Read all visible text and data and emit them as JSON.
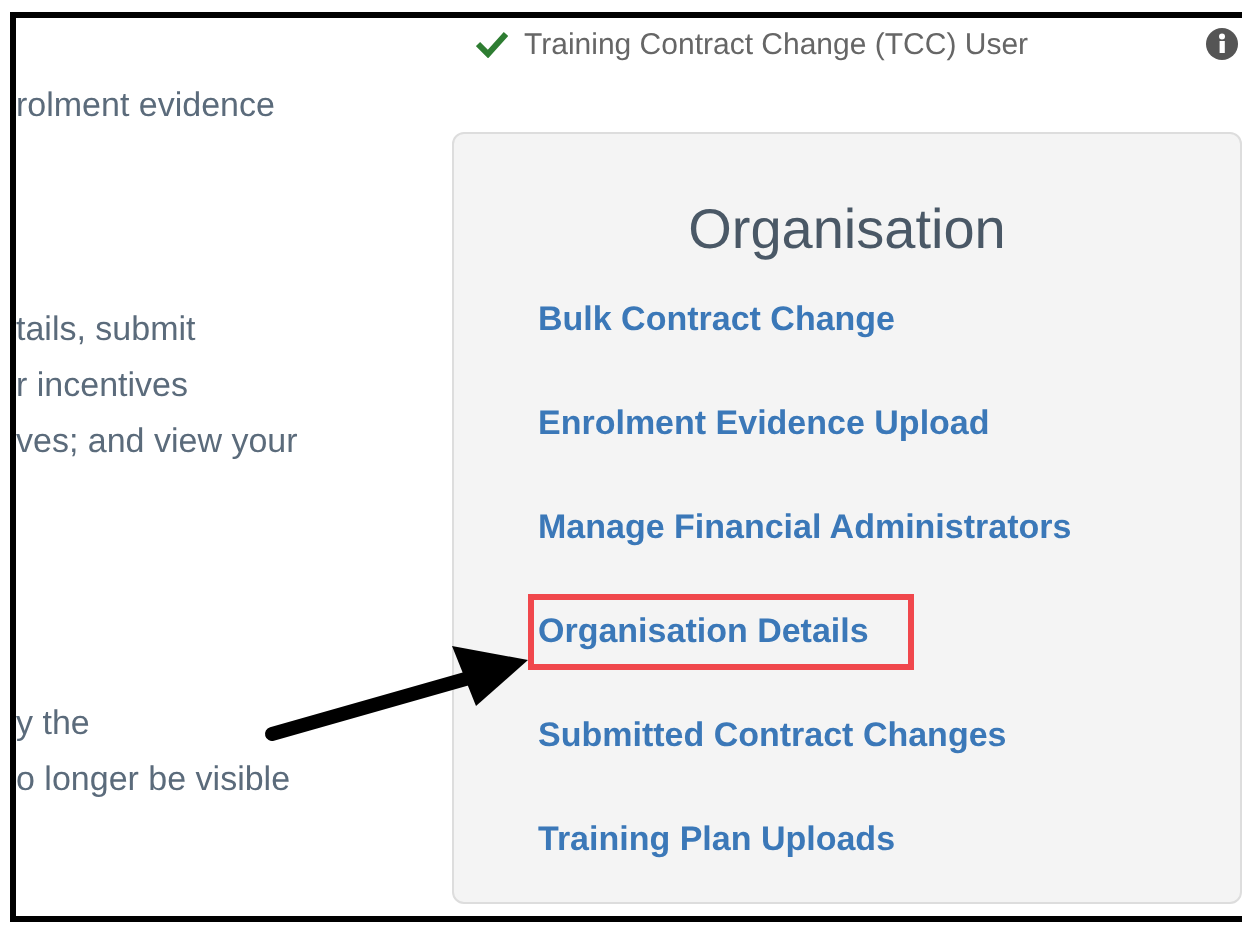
{
  "left_text": [
    {
      "lines": [
        "rolment evidence"
      ]
    },
    {
      "lines": [
        "tails, submit",
        "r incentives",
        "ves; and view your"
      ]
    },
    {
      "lines": [
        "y the",
        "o longer be visible"
      ]
    }
  ],
  "user_role": {
    "label": "Training Contract Change (TCC) User",
    "verified": true
  },
  "panel": {
    "title": "Organisation",
    "links": [
      {
        "label": "Bulk Contract Change",
        "highlighted": false
      },
      {
        "label": "Enrolment Evidence Upload",
        "highlighted": false
      },
      {
        "label": "Manage Financial Administrators",
        "highlighted": false
      },
      {
        "label": "Organisation Details",
        "highlighted": true
      },
      {
        "label": "Submitted Contract Changes",
        "highlighted": false
      },
      {
        "label": "Training Plan Uploads",
        "highlighted": false
      }
    ]
  }
}
